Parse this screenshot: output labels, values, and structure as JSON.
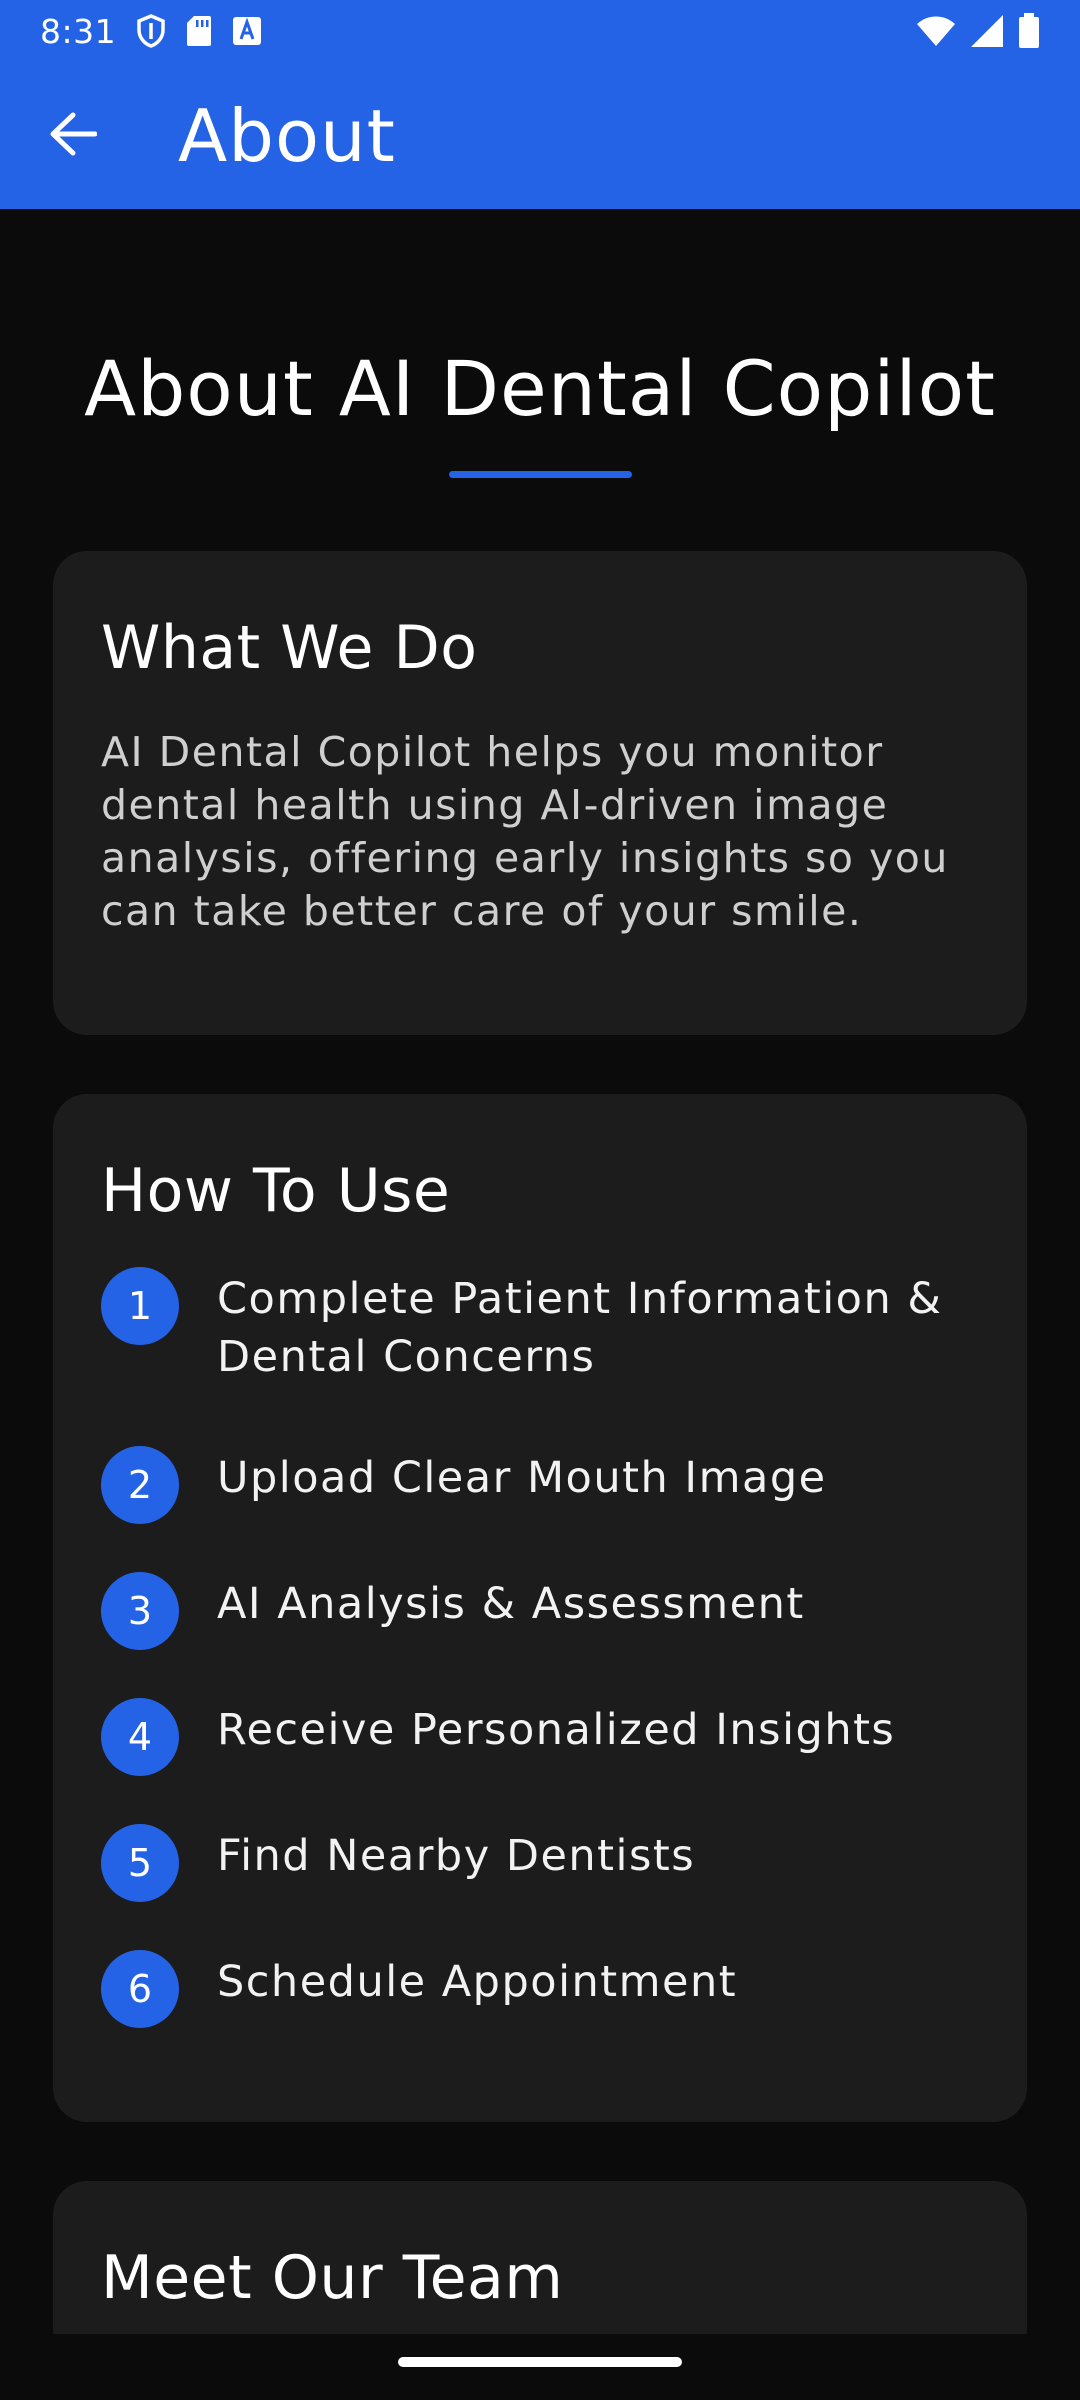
{
  "status_bar": {
    "time": "8:31",
    "left_icons": [
      "shield-icon",
      "sd-card-icon",
      "text-a-icon"
    ],
    "right_icons": [
      "wifi-icon",
      "signal-icon",
      "battery-icon"
    ]
  },
  "app_bar": {
    "title": "About",
    "back_icon": "arrow-left-icon",
    "color": "#2563e6"
  },
  "page": {
    "heading": "About AI Dental Copilot"
  },
  "what_we_do": {
    "title": "What We Do",
    "body": "AI Dental Copilot helps you monitor dental health using AI-driven image analysis, offering early insights so you can take better care of your smile."
  },
  "how_to_use": {
    "title": "How To Use",
    "steps": [
      {
        "number": "1",
        "label": "Complete Patient Information & Dental Concerns"
      },
      {
        "number": "2",
        "label": "Upload Clear Mouth Image"
      },
      {
        "number": "3",
        "label": "AI Analysis & Assessment"
      },
      {
        "number": "4",
        "label": "Receive Personalized Insights"
      },
      {
        "number": "5",
        "label": "Find Nearby Dentists"
      },
      {
        "number": "6",
        "label": "Schedule Appointment"
      }
    ]
  },
  "team": {
    "title": "Meet Our Team"
  },
  "colors": {
    "accent": "#2563e6",
    "background": "#0b0b0b",
    "card": "#1c1c1c"
  }
}
